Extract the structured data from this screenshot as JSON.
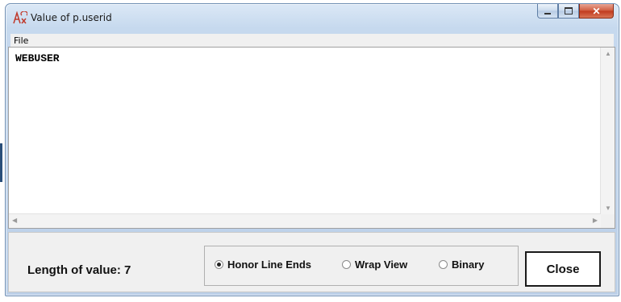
{
  "window": {
    "title": "Value of p.userid"
  },
  "menu": {
    "file": "File"
  },
  "editor": {
    "content": "WEBUSER"
  },
  "footer": {
    "length_label": "Length of value: 7",
    "options": [
      "Honor Line Ends",
      "Wrap View",
      "Binary"
    ],
    "selected": "Honor Line Ends",
    "close_label": "Close"
  },
  "colors": {
    "close_caption": "#c0391c",
    "titlebar": "#c6d9ee"
  }
}
